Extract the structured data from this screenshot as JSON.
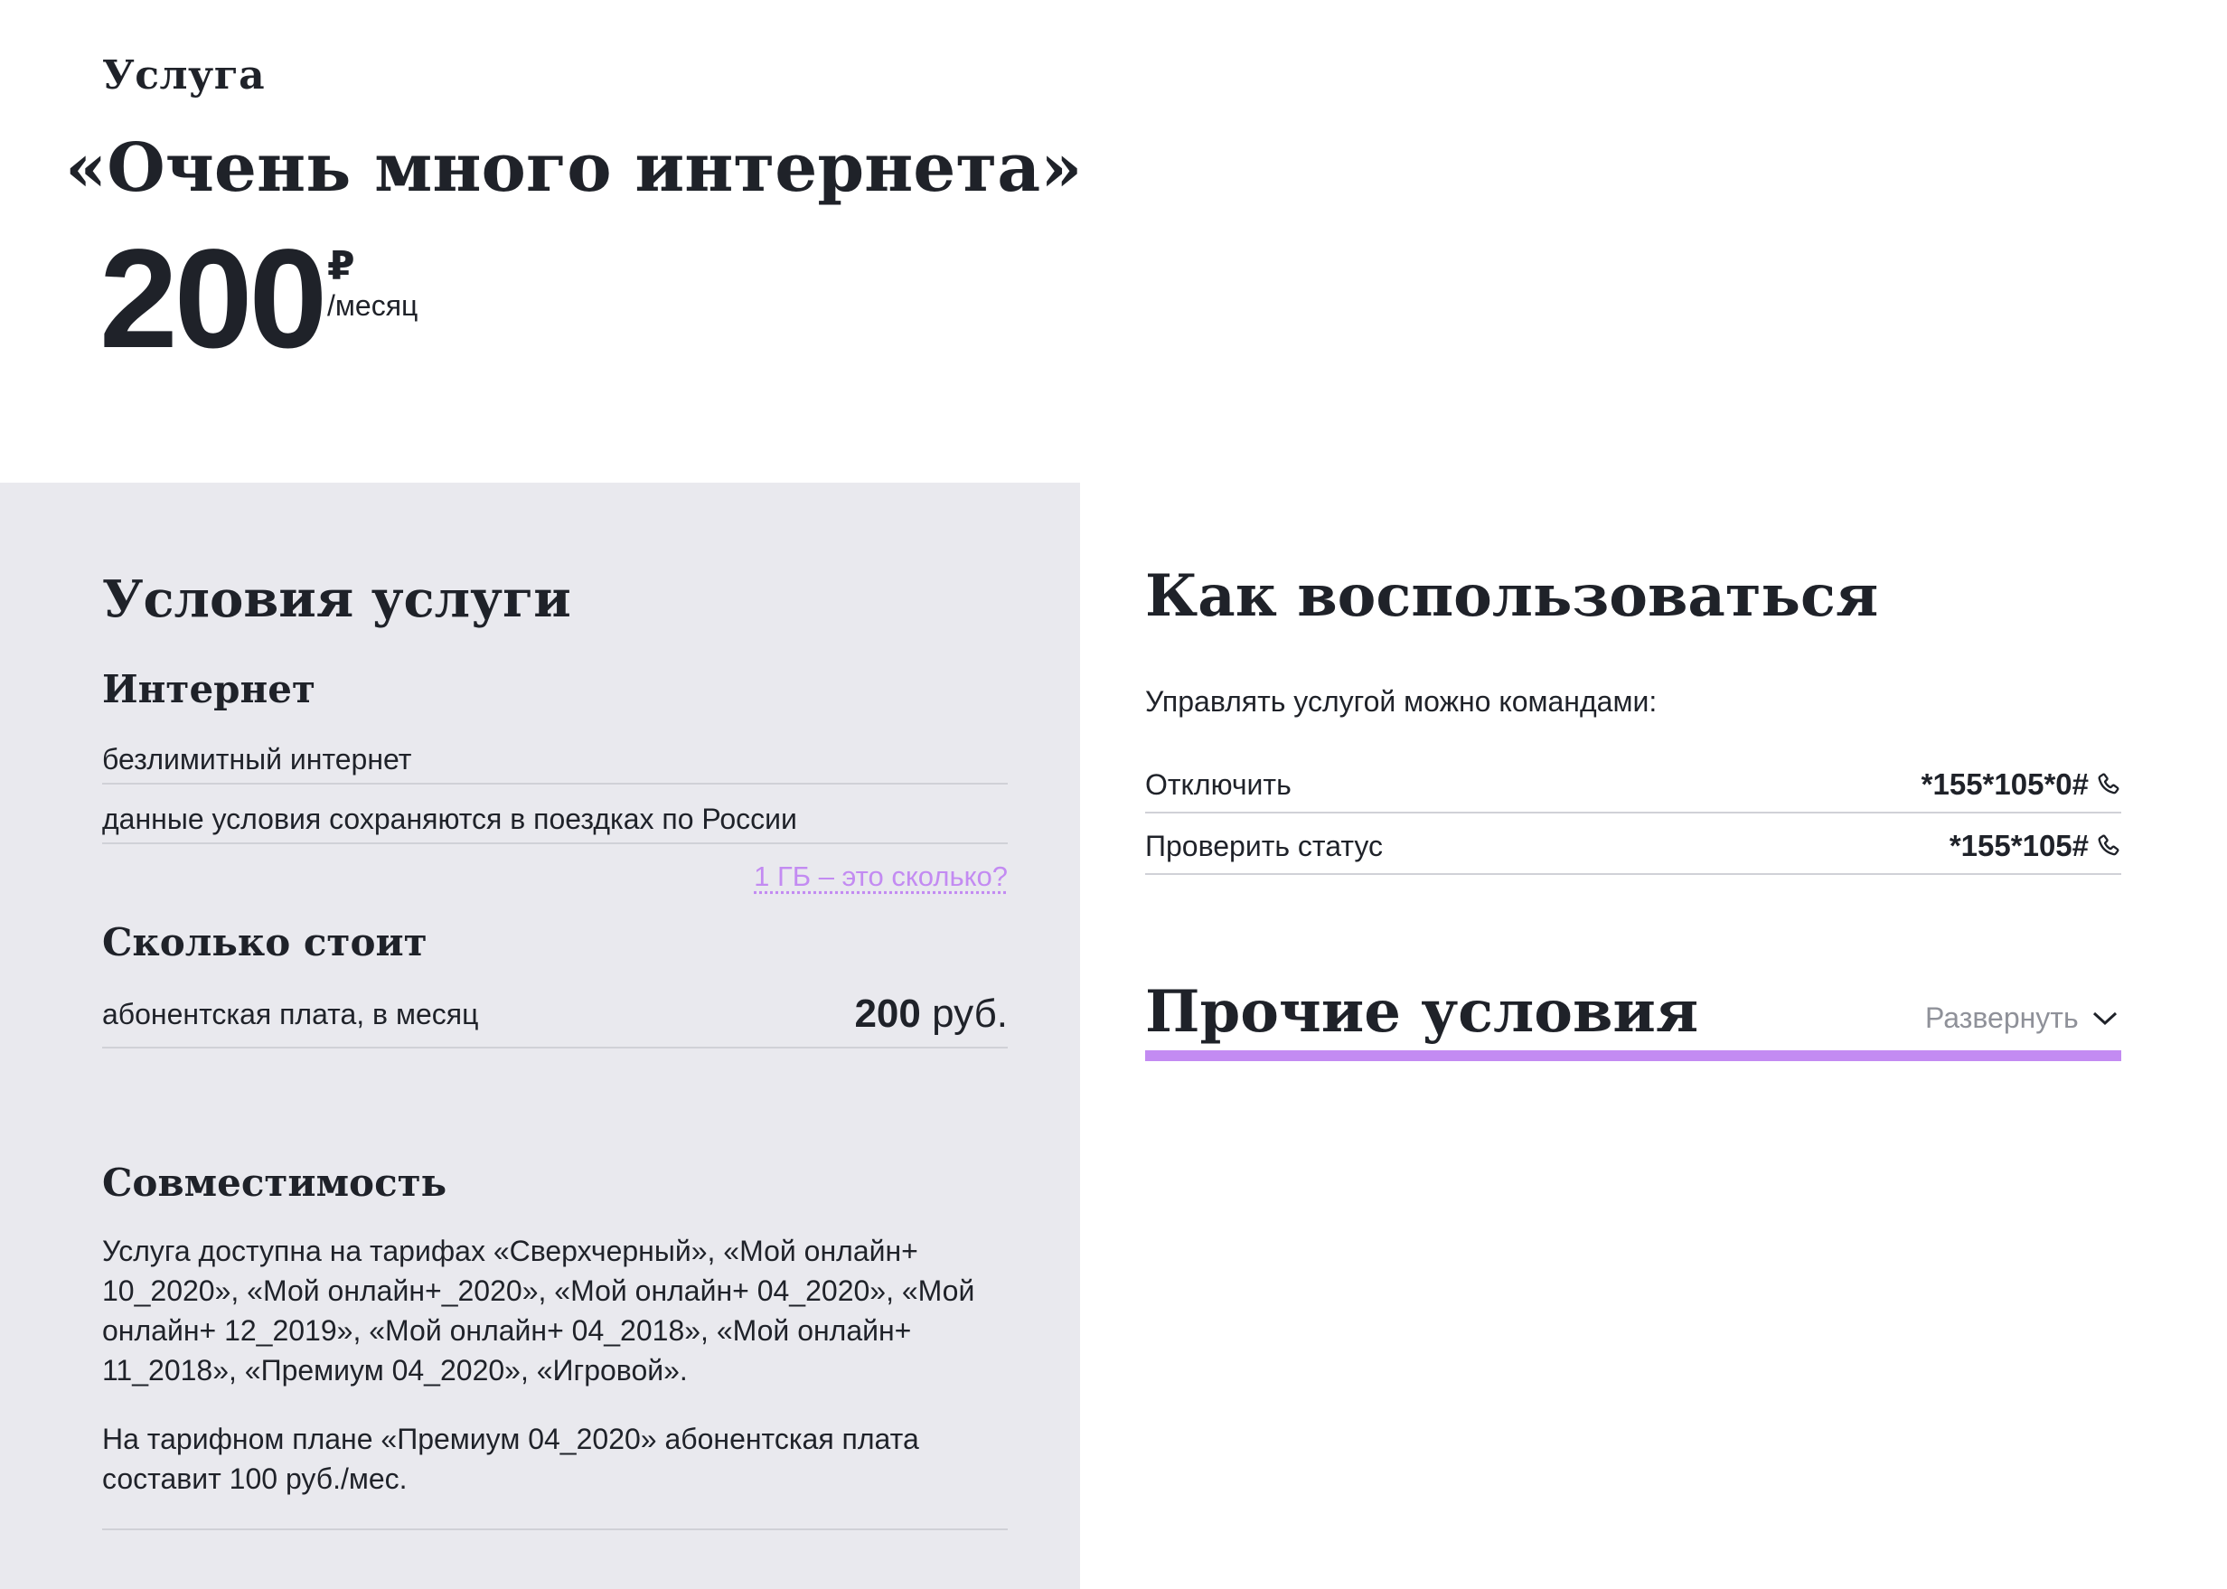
{
  "header": {
    "eyebrow": "Услуга",
    "title": "«Очень много интернета»",
    "price_value": "200",
    "price_currency": "₽",
    "price_period": "/месяц"
  },
  "conditions": {
    "title": "Условия услуги",
    "internet": {
      "title": "Интернет",
      "items": [
        "безлимитный интернет",
        "данные условия сохраняются в поездках по России"
      ],
      "link": "1 ГБ – это сколько?"
    },
    "cost": {
      "title": "Сколько стоит",
      "label": "абонентская плата, в месяц",
      "amount": "200",
      "unit": "руб."
    },
    "compatibility": {
      "title": "Совместимость",
      "p1": "Услуга доступна на тарифах «Сверхчерный», «Мой онлайн+ 10_2020», «Мой онлайн+_2020», «Мой онлайн+ 04_2020», «Мой онлайн+ 12_2019», «Мой онлайн+ 04_2018», «Мой онлайн+ 11_2018», «Премиум 04_2020», «Игровой».",
      "p2": "На тарифном плане «Премиум 04_2020» абонентская плата составит 100 руб./мес."
    }
  },
  "usage": {
    "title": "Как воспользоваться",
    "intro": "Управлять услугой можно командами:",
    "commands": [
      {
        "label": "Отключить",
        "code": "*155*105*0#",
        "icon": "phone-icon"
      },
      {
        "label": "Проверить статус",
        "code": "*155*105#",
        "icon": "phone-icon"
      }
    ]
  },
  "other": {
    "title": "Прочие условия",
    "expand_label": "Развернуть",
    "expand_icon": "chevron-down-icon"
  },
  "colors": {
    "accent": "#c38bf2",
    "panel_bg": "#e9e9ee",
    "text": "#1f2229",
    "muted": "#8f9199"
  }
}
